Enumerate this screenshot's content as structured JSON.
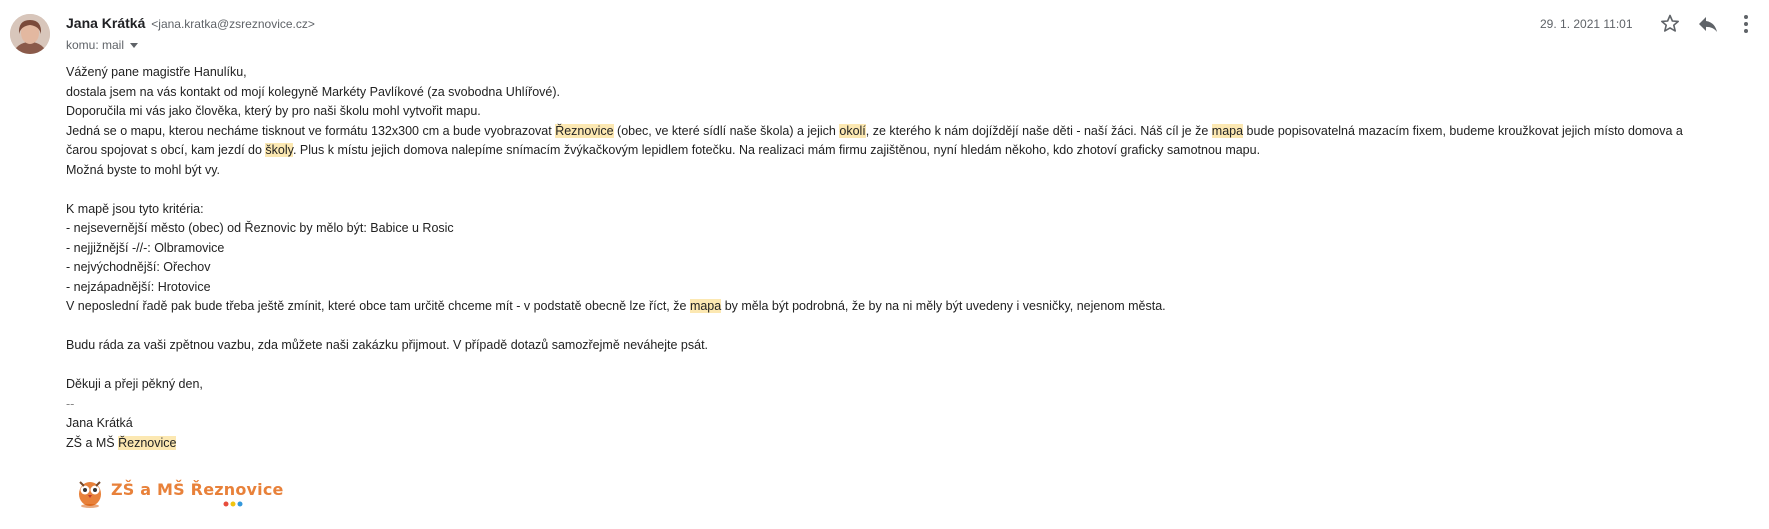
{
  "header": {
    "sender_name": "Jana Krátká",
    "sender_email": "<jana.kratka@zsreznovice.cz>",
    "to_label": "komu: mail",
    "date": "29. 1. 2021 11:01"
  },
  "icons": {
    "avatar": "avatar-photo",
    "star": "star-icon",
    "reply": "reply-icon",
    "more": "more-vert-icon"
  },
  "body": {
    "greeting": "Vážený pane magistře Hanulíku,",
    "line1": "dostala jsem na vás kontakt od mojí kolegyně Markéty Pavlíkové (za svobodna Uhlířové).",
    "line2": "Doporučila mi vás jako člověka, který by pro naši školu mohl vytvořit mapu.",
    "p3": {
      "a": "Jedná se o mapu, kterou necháme tisknout ve formátu 132x300 cm a bude vyobrazovat ",
      "h1": "Řeznovice",
      "b": " (obec, ve které sídlí naše škola) a jejich ",
      "h2": "okolí",
      "c": ", ze kterého k nám dojíždějí naše děti - naší žáci. Náš cíl je že ",
      "h3": "mapa",
      "d": " bude popisovatelná mazacím fixem, budeme kroužkovat jejich místo domova a"
    },
    "p4": {
      "a": "čarou spojovat s obcí, kam jezdí do ",
      "h1": "školy",
      "b": ". Plus k místu jejich domova nalepíme snímacím žvýkačkovým lepidlem fotečku. Na realizaci mám firmu zajištěnou, nyní hledám někoho, kdo zhotoví graficky samotnou mapu."
    },
    "line5": "Možná byste to mohl být vy.",
    "criteria_title": "K mapě jsou tyto kritéria:",
    "criteria": [
      "- nejsevernější město (obec) od Řeznovic by mělo být: Babice u Rosic",
      "- nejjižnější -//-: Olbramovice",
      "- nejvýchodnější: Ořechov",
      "- nejzápadnější: Hrotovice"
    ],
    "p6": {
      "a": "V neposlední řadě pak bude třeba ještě zmínit, které obce tam určitě chceme mít - v podstatě obecně lze říct, že ",
      "h1": "mapa",
      "b": " by měla být podrobná, že by na ni měly být uvedeny i vesničky, nejenom města."
    },
    "feedback": "Budu ráda za vaši zpětnou vazbu, zda můžete naši zakázku přijmout. V případě dotazů samozřejmě neváhejte psát.",
    "closing": "Děkuji a přeji pěkný den,",
    "sig_dash": "--",
    "sig_name": "Jana Krátká",
    "sig_org_prefix": "ZŠ a MŠ ",
    "sig_org_highlight": "Řeznovice"
  },
  "logo": {
    "text": "ZŠ a MŠ Řeznovice",
    "accent_color": "#e8813a"
  },
  "colors": {
    "highlight": "#fce8b2",
    "meta_text": "#5f6368"
  }
}
